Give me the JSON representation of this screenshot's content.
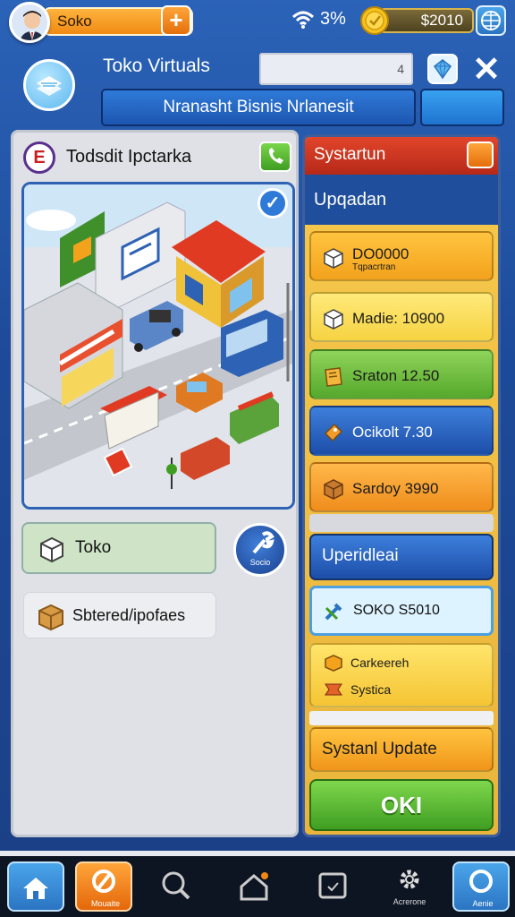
{
  "top_bar": {
    "player_name": "Soko",
    "plus_label": "+",
    "signal": "3%",
    "coins": "$2010"
  },
  "header": {
    "app_title": "Toko Virtuals",
    "search_hint": "4",
    "close_label": "✕",
    "subtitle": "Nranasht Bisnis Nrlanesit"
  },
  "left_panel": {
    "icon_letter": "E",
    "title": "Todsdit Ipctarka",
    "check_label": "✓",
    "toko_button": "Toko",
    "tool_label": "Socio",
    "stored_button": "Sbtered/ipofaes"
  },
  "right_panel": {
    "header": "Systartun",
    "subheader": "Upqadan",
    "items": [
      {
        "label": "DO0000",
        "sub": "Tqpacrtran",
        "style": "orange"
      },
      {
        "label": "Madie: 10900",
        "sub": "",
        "style": "yellow"
      },
      {
        "label": "Sraton 12.50",
        "sub": "",
        "style": "green"
      },
      {
        "label": "Ocikolt 7.30",
        "sub": "",
        "style": "blue"
      },
      {
        "label": "Sardoy 3990",
        "sub": "",
        "style": "orange2"
      }
    ],
    "update_section": "Uperidleai",
    "soko_value": "SOKO S5010",
    "pair": [
      "Carkeereh",
      "Systica"
    ],
    "system_update": "Systanl Update",
    "ok": "OKI"
  },
  "bottom_nav": {
    "q_label": "Mouaite",
    "gear_label": "Acrerone",
    "circle_label": "Aenie"
  },
  "colors": {
    "background_blue": "#2b63b8",
    "orange_accent": "#f08a14",
    "green_ok": "#3f9e22",
    "header_red": "#c8321d"
  }
}
